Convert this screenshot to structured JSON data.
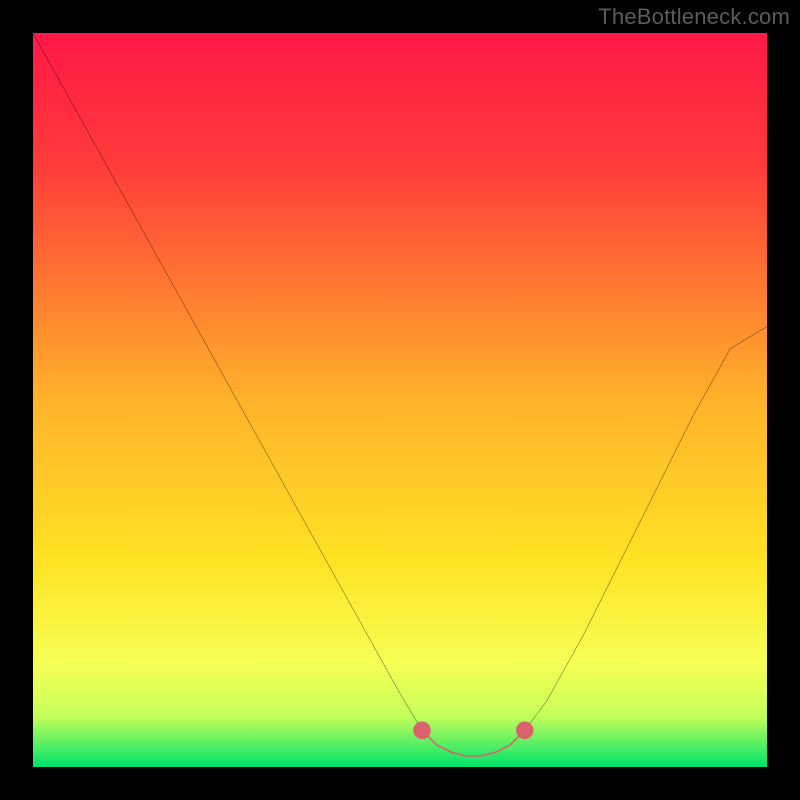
{
  "watermark": "TheBottleneck.com",
  "chart_data": {
    "type": "line",
    "title": "",
    "xlabel": "",
    "ylabel": "",
    "xlim": [
      0,
      100
    ],
    "ylim": [
      0,
      100
    ],
    "gradient_stops": [
      {
        "pct": 0,
        "color": "#ff1846"
      },
      {
        "pct": 18,
        "color": "#ff3b3a"
      },
      {
        "pct": 50,
        "color": "#ffb22a"
      },
      {
        "pct": 72,
        "color": "#ffe324"
      },
      {
        "pct": 86,
        "color": "#f6ff55"
      },
      {
        "pct": 93,
        "color": "#c6ff5a"
      },
      {
        "pct": 100,
        "color": "#00e36b"
      }
    ],
    "series": [
      {
        "name": "bottleneck-curve",
        "color": "#000000",
        "x": [
          0,
          5,
          10,
          15,
          20,
          25,
          30,
          35,
          40,
          45,
          50,
          53,
          55,
          57,
          59,
          61,
          63,
          65,
          67,
          70,
          75,
          80,
          85,
          90,
          95,
          100
        ],
        "y": [
          100,
          91,
          82,
          73,
          64,
          55,
          46,
          37,
          28,
          19,
          10,
          5,
          3,
          2,
          1.5,
          1.5,
          2,
          3,
          5,
          9,
          18,
          28,
          38,
          48,
          57,
          60
        ]
      },
      {
        "name": "optimal-marker",
        "color": "#d9626c",
        "x": [
          53,
          55,
          57,
          59,
          61,
          63,
          65,
          67
        ],
        "y": [
          5,
          3,
          2,
          1.5,
          1.5,
          2,
          3,
          5
        ]
      }
    ],
    "optimal_range_x": [
      53,
      67
    ]
  }
}
